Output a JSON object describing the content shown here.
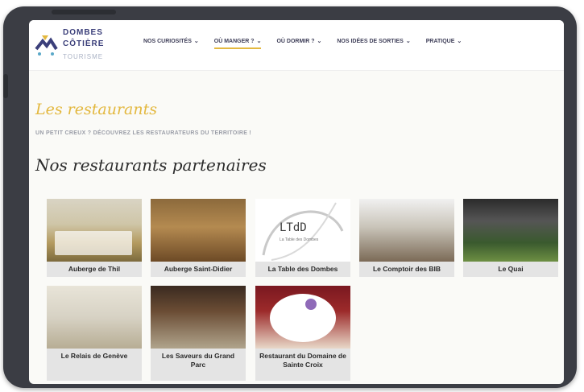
{
  "brand": {
    "line1": "DOMBES",
    "line2": "CÔTIÈRE",
    "line3": "TOURISME"
  },
  "nav": {
    "items": [
      {
        "label": "NOS CURIOSITÉS",
        "active": false
      },
      {
        "label": "OÙ MANGER ?",
        "active": true
      },
      {
        "label": "OÙ DORMIR ?",
        "active": false
      },
      {
        "label": "NOS IDÉES DE SORTIES",
        "active": false
      },
      {
        "label": "PRATIQUE",
        "active": false
      }
    ]
  },
  "page": {
    "title": "Les restaurants",
    "subtitle": "UN PETIT CREUX ? DÉCOUVREZ LES RESTAURATEURS DU TERRITOIRE !",
    "section_title": "Nos restaurants partenaires"
  },
  "restaurants": [
    {
      "name": "Auberge de Thil"
    },
    {
      "name": "Auberge Saint-Didier"
    },
    {
      "name": "La Table des Dombes",
      "logo_text": "LTdD",
      "logo_sub": "La Table des Dombes"
    },
    {
      "name": "Le Comptoir des BIB"
    },
    {
      "name": "Le Quai"
    },
    {
      "name": "Le Relais de Genève"
    },
    {
      "name": "Les Saveurs du Grand Parc"
    },
    {
      "name": "Restaurant du Domaine de Sainte Croix"
    }
  ],
  "colors": {
    "accent": "#e3b83f",
    "brand": "#3b3f7a",
    "device_frame": "#3b3d44"
  }
}
